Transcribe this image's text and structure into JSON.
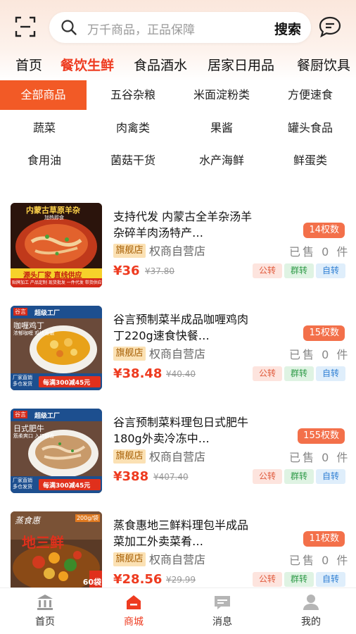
{
  "header": {
    "search_placeholder": "万千商品，正品保障",
    "search_button": "搜索",
    "icons": {
      "scan": "scan-icon",
      "search": "search-icon",
      "message": "chat-icon"
    }
  },
  "tabs": [
    "首页",
    "餐饮生鲜",
    "食品酒水",
    "居家日用品",
    "餐厨饮具"
  ],
  "active_tab": "餐饮生鲜",
  "categories": [
    "全部商品",
    "五谷杂粮",
    "米面淀粉类",
    "方便速食",
    "蔬菜",
    "肉禽类",
    "果酱",
    "罐头食品",
    "食用油",
    "菌菇干货",
    "水产海鲜",
    "鲜蛋类"
  ],
  "active_category": "全部商品",
  "products": [
    {
      "title": "支持代发 内蒙古全羊杂汤羊杂碎羊肉汤特产…",
      "flag": "旗舰店",
      "store": "权商自营店",
      "price": "¥36",
      "original_price": "¥37.80",
      "rights": "14权数",
      "sold": "已售 0 件",
      "tags": [
        "公转",
        "群转",
        "自转"
      ],
      "image_text": {
        "top": "内蒙古草原羊杂",
        "sub": "加热即食",
        "band": "源头厂家 直线供应",
        "foot": "贴牌加工 产品定制 现货批发 一件代发 带货供应链"
      }
    },
    {
      "title": "谷言预制菜半成品咖喱鸡肉丁220g速食快餐…",
      "flag": "旗舰店",
      "store": "权商自营店",
      "price": "¥38.48",
      "original_price": "¥40.40",
      "rights": "15权数",
      "sold": "已售 0 件",
      "tags": [
        "公转",
        "群转",
        "自转"
      ],
      "image_text": {
        "brand": "谷言",
        "factory": "超级工厂",
        "name": "咖喱鸡丁",
        "sub": "浓郁咖喱 鸡块香嫩",
        "corner": "厂家直销 多仓发货",
        "promo": "每满300减45元"
      }
    },
    {
      "title": "谷言预制菜料理包日式肥牛180g外卖冷冻中…",
      "flag": "旗舰店",
      "store": "权商自营店",
      "price": "¥388",
      "original_price": "¥407.40",
      "rights": "155权数",
      "sold": "已售 0 件",
      "tags": [
        "公转",
        "群转",
        "自转"
      ],
      "image_text": {
        "brand": "谷言",
        "factory": "超级工厂",
        "name": "日式肥牛",
        "sub": "筋柔爽口 入口鲜香",
        "corner": "厂家直销 多仓发货",
        "promo": "每满300减45元"
      }
    },
    {
      "title": "蒸食惠地三鲜料理包半成品菜加工外卖菜肴…",
      "flag": "旗舰店",
      "store": "权商自营店",
      "price": "¥28.56",
      "original_price": "¥29.99",
      "rights": "11权数",
      "sold": "已售 0 件",
      "tags": [
        "公转",
        "群转",
        "自转"
      ],
      "image_text": {
        "brand": "蒸食惠",
        "name": "地三鲜",
        "weight": "200g/袋",
        "count": "60袋"
      }
    }
  ],
  "bottom_nav": [
    {
      "label": "首页",
      "icon": "bank-icon"
    },
    {
      "label": "商城",
      "icon": "shop-icon"
    },
    {
      "label": "消息",
      "icon": "message-icon"
    },
    {
      "label": "我的",
      "icon": "user-icon"
    }
  ],
  "active_bottom": "商城",
  "colors": {
    "accent": "#ee3b20",
    "category_active": "#f25a26",
    "rights_badge": "#f3704a",
    "flag_bg": "#fbe1b4"
  }
}
